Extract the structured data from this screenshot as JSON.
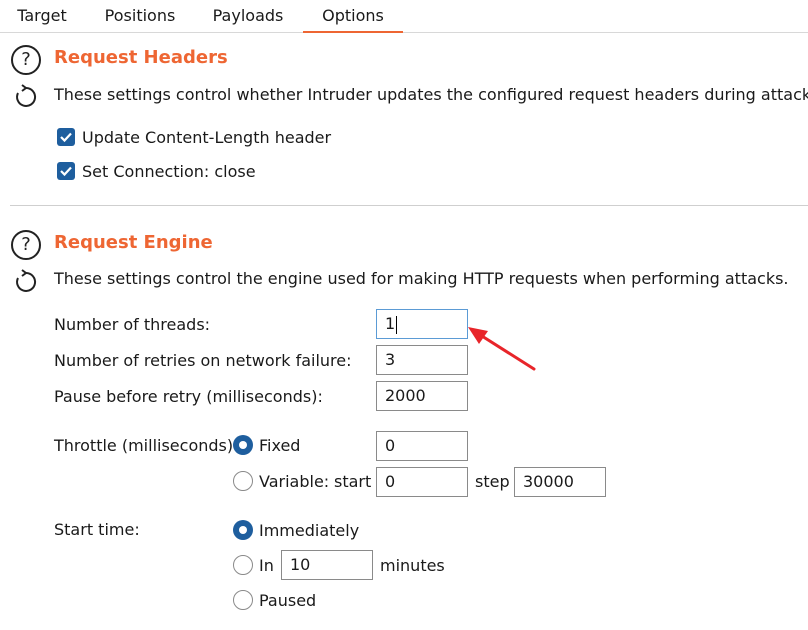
{
  "tabs": [
    {
      "label": "Target"
    },
    {
      "label": "Positions"
    },
    {
      "label": "Payloads"
    },
    {
      "label": "Options",
      "active": true
    }
  ],
  "accent_color": "#ee6633",
  "request_headers": {
    "title": "Request Headers",
    "description": "These settings control whether Intruder updates the configured request headers during attacks.",
    "options": [
      {
        "label": "Update Content-Length header",
        "checked": true
      },
      {
        "label": "Set Connection: close",
        "checked": true
      }
    ]
  },
  "request_engine": {
    "title": "Request Engine",
    "description": "These settings control the engine used for making HTTP requests when performing attacks.",
    "threads": {
      "label": "Number of threads:",
      "value": "1"
    },
    "retries": {
      "label": "Number of retries on network failure:",
      "value": "3"
    },
    "pause": {
      "label": "Pause before retry (milliseconds):",
      "value": "2000"
    },
    "throttle": {
      "label": "Throttle (milliseconds):",
      "fixed_label": "Fixed",
      "fixed_value": "0",
      "variable_label": "Variable:",
      "start_label": "start",
      "start_value": "0",
      "step_label": "step",
      "step_value": "30000",
      "selected": "Fixed"
    },
    "start_time": {
      "label": "Start time:",
      "immediately_label": "Immediately",
      "in_label": "In",
      "in_value": "10",
      "minutes_label": "minutes",
      "paused_label": "Paused",
      "selected": "Immediately"
    }
  }
}
